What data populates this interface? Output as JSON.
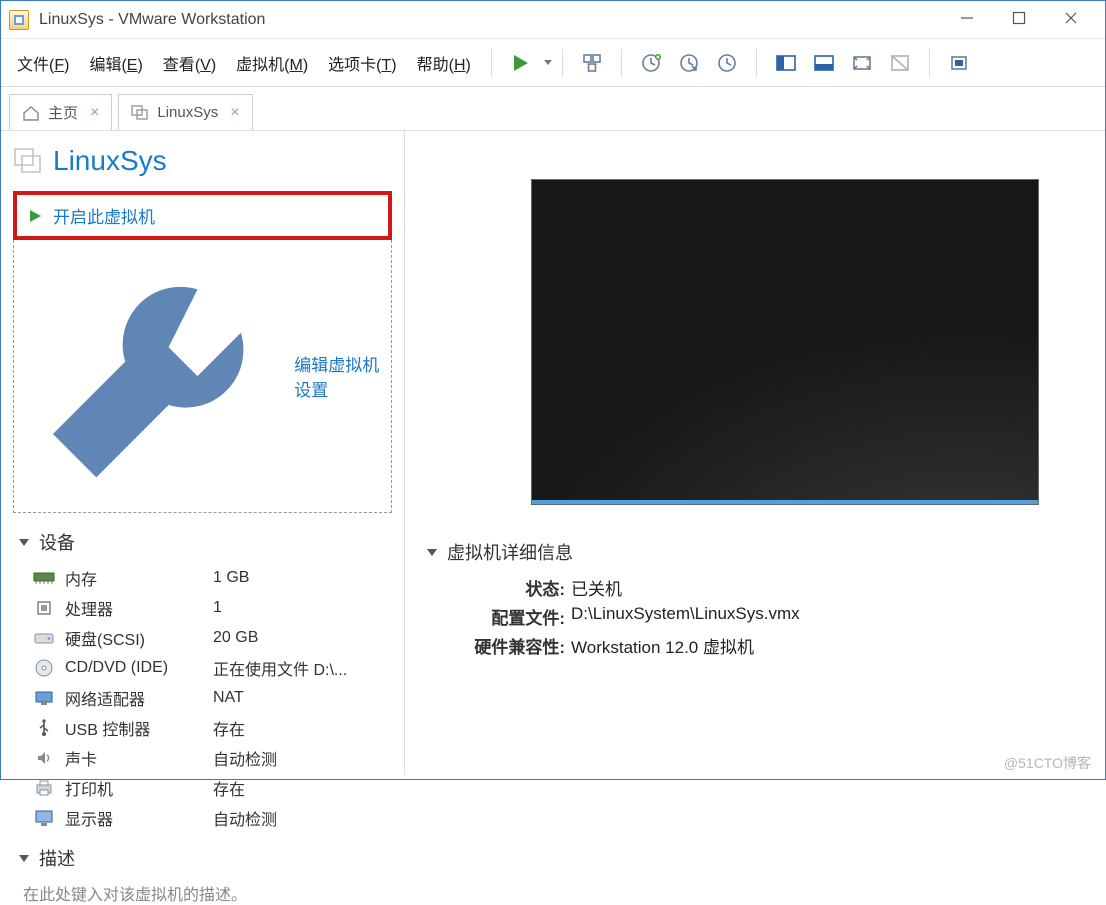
{
  "window": {
    "title": "LinuxSys - VMware Workstation"
  },
  "menu": {
    "items": [
      {
        "label": "文件",
        "mnemonic": "F"
      },
      {
        "label": "编辑",
        "mnemonic": "E"
      },
      {
        "label": "查看",
        "mnemonic": "V"
      },
      {
        "label": "虚拟机",
        "mnemonic": "M"
      },
      {
        "label": "选项卡",
        "mnemonic": "T"
      },
      {
        "label": "帮助",
        "mnemonic": "H"
      }
    ]
  },
  "tabs": {
    "home": {
      "label": "主页"
    },
    "active": {
      "label": "LinuxSys"
    }
  },
  "vm": {
    "name": "LinuxSys",
    "actions": {
      "power_on": "开启此虚拟机",
      "edit_settings": "编辑虚拟机设置"
    }
  },
  "devices": {
    "section_title": "设备",
    "rows": [
      {
        "icon": "memory-icon",
        "label": "内存",
        "value": "1 GB"
      },
      {
        "icon": "cpu-icon",
        "label": "处理器",
        "value": "1"
      },
      {
        "icon": "disk-icon",
        "label": "硬盘(SCSI)",
        "value": "20 GB"
      },
      {
        "icon": "cd-icon",
        "label": "CD/DVD (IDE)",
        "value": "正在使用文件 D:\\..."
      },
      {
        "icon": "nic-icon",
        "label": "网络适配器",
        "value": "NAT"
      },
      {
        "icon": "usb-icon",
        "label": "USB 控制器",
        "value": "存在"
      },
      {
        "icon": "sound-icon",
        "label": "声卡",
        "value": "自动检测"
      },
      {
        "icon": "printer-icon",
        "label": "打印机",
        "value": "存在"
      },
      {
        "icon": "display-icon",
        "label": "显示器",
        "value": "自动检测"
      }
    ]
  },
  "description": {
    "section_title": "描述",
    "placeholder": "在此处键入对该虚拟机的描述。"
  },
  "details": {
    "section_title": "虚拟机详细信息",
    "rows": [
      {
        "label": "状态:",
        "value": "已关机"
      },
      {
        "label": "配置文件:",
        "value": "D:\\LinuxSystem\\LinuxSys.vmx"
      },
      {
        "label": "硬件兼容性:",
        "value": "Workstation 12.0 虚拟机"
      }
    ]
  },
  "watermark": "@51CTO博客"
}
